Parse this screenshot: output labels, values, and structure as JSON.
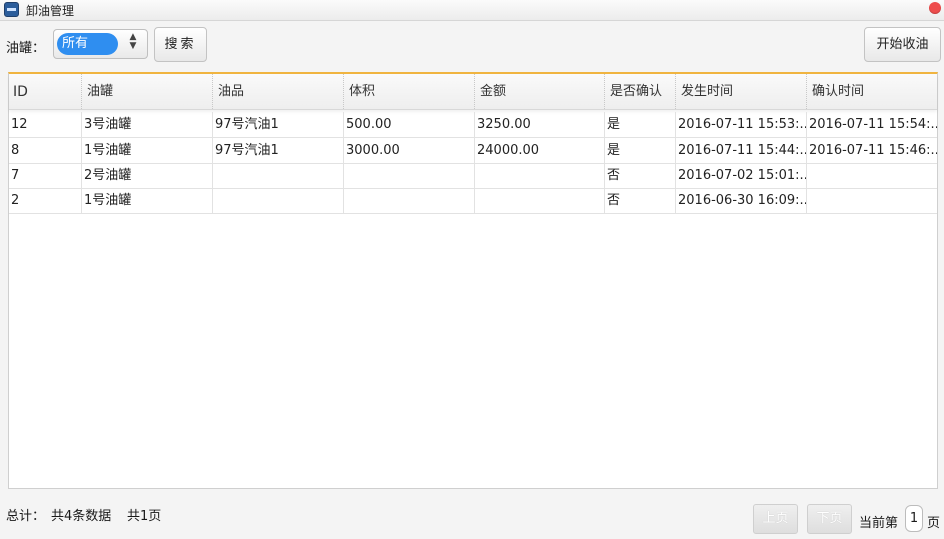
{
  "window": {
    "title": "卸油管理"
  },
  "filter": {
    "tank_label": "油罐：",
    "tank_select_value": "所有",
    "search_label": "搜索"
  },
  "actions": {
    "start_receiving_label": "开始收油"
  },
  "table": {
    "columns": [
      "ID",
      "油罐",
      "油品",
      "体积",
      "金额",
      "是否确认",
      "发生时间",
      "确认时间"
    ],
    "rows": [
      [
        "12",
        "3号油罐",
        "97号汽油1",
        "500.00",
        "3250.00",
        "是",
        "2016-07-11 15:53:...",
        "2016-07-11 15:54:..."
      ],
      [
        "8",
        "1号油罐",
        "97号汽油1",
        "3000.00",
        "24000.00",
        "是",
        "2016-07-11 15:44:...",
        "2016-07-11 15:46:..."
      ],
      [
        "7",
        "2号油罐",
        "",
        "",
        "",
        "否",
        "2016-07-02 15:01:...",
        ""
      ],
      [
        "2",
        "1号油罐",
        "",
        "",
        "",
        "否",
        "2016-06-30 16:09:...",
        ""
      ]
    ]
  },
  "footer": {
    "total_label": "总计：",
    "record_count_text": "共4条数据",
    "page_count_text": "共1页",
    "prev_page_label": "上页",
    "next_page_label": "下页",
    "current_page_prefix": "当前第",
    "current_page": "1",
    "current_page_suffix": "页"
  },
  "colors": {
    "accent_select": "#2f8ef0",
    "table_top_border": "#f0b440",
    "close_button": "#ee4d4d"
  }
}
